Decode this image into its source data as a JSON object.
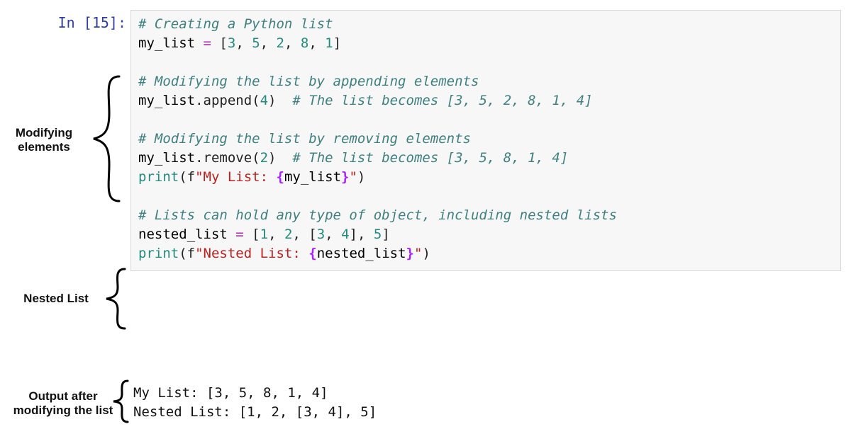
{
  "prompt": {
    "in": "In [",
    "num": "15",
    "close": "]:"
  },
  "code": {
    "l1_c": "# Creating a Python list",
    "l2_a": "my_list",
    "l2_b": " = ",
    "l2_c": "[",
    "l2_d": "3",
    "l2_e": ", ",
    "l2_f": "5",
    "l2_g": ", ",
    "l2_h": "2",
    "l2_i": ", ",
    "l2_j": "8",
    "l2_k": ", ",
    "l2_l": "1",
    "l2_m": "]",
    "l4_c": "# Modifying the list by appending elements",
    "l5_a": "my_list",
    "l5_b": ".append(",
    "l5_c": "4",
    "l5_d": ")  ",
    "l5_e": "# The list becomes [3, 5, 2, 8, 1, 4]",
    "l7_c": "# Modifying the list by removing elements",
    "l8_a": "my_list",
    "l8_b": ".remove(",
    "l8_c": "2",
    "l8_d": ")  ",
    "l8_e": "# The list becomes [3, 5, 8, 1, 4]",
    "l9_a": "print",
    "l9_b": "(f",
    "l9_c": "\"My List: ",
    "l9_d": "{",
    "l9_e": "my_list",
    "l9_f": "}",
    "l9_g": "\"",
    "l9_h": ")",
    "l11_c": "# Lists can hold any type of object, including nested lists",
    "l12_a": "nested_list",
    "l12_b": " = ",
    "l12_c": "[",
    "l12_d": "1",
    "l12_e": ", ",
    "l12_f": "2",
    "l12_g": ", [",
    "l12_h": "3",
    "l12_i": ", ",
    "l12_j": "4",
    "l12_k": "], ",
    "l12_l": "5",
    "l12_m": "]",
    "l13_a": "print",
    "l13_b": "(f",
    "l13_c": "\"Nested List: ",
    "l13_d": "{",
    "l13_e": "nested_list",
    "l13_f": "}",
    "l13_g": "\"",
    "l13_h": ")"
  },
  "output": {
    "l1": "My List: [3, 5, 8, 1, 4]",
    "l2": "Nested List: [1, 2, [3, 4], 5]"
  },
  "annotations": {
    "modifying_l1": "Modifying",
    "modifying_l2": "elements",
    "nested": "Nested List",
    "output_l1": "Output after",
    "output_l2": "modifying the list"
  }
}
